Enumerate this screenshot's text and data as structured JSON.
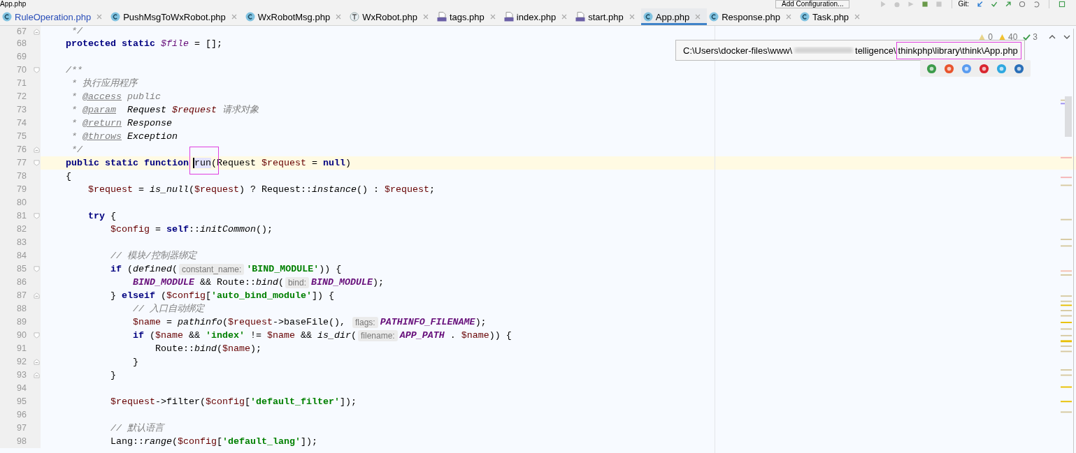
{
  "top_bar": {
    "title": "App.php",
    "run_config_button": "Add Configuration...",
    "vcs_label": "Git:"
  },
  "tabs": [
    {
      "label": "RuleOperation.php",
      "kind": "class",
      "selected": false,
      "modified": true
    },
    {
      "label": "PushMsgToWxRobot.php",
      "kind": "class",
      "selected": false,
      "modified": false
    },
    {
      "label": "WxRobotMsg.php",
      "kind": "class",
      "selected": false,
      "modified": false
    },
    {
      "label": "WxRobot.php",
      "kind": "trait",
      "selected": false,
      "modified": false
    },
    {
      "label": "tags.php",
      "kind": "php",
      "selected": false,
      "modified": false
    },
    {
      "label": "index.php",
      "kind": "php",
      "selected": false,
      "modified": false
    },
    {
      "label": "start.php",
      "kind": "php",
      "selected": false,
      "modified": false
    },
    {
      "label": "App.php",
      "kind": "class",
      "selected": true,
      "modified": false
    },
    {
      "label": "Response.php",
      "kind": "class",
      "selected": false,
      "modified": false
    },
    {
      "label": "Task.php",
      "kind": "class",
      "selected": false,
      "modified": false
    }
  ],
  "inspection": {
    "weak_warnings": "0",
    "warnings": "40",
    "passed": "3"
  },
  "tooltip": {
    "path_start": "C:\\Users\\docker-files\\www\\",
    "path_middle": "telligence\\",
    "path_highlight": "thinkphp\\library\\think\\App.php"
  },
  "editor": {
    "lines": [
      {
        "number": "67",
        "current": false,
        "fold": {
          "kind": "end"
        },
        "tokens": [
          {
            "kind": "comment",
            "text": "     */"
          }
        ]
      },
      {
        "number": "68",
        "current": false,
        "tokens": [
          {
            "kind": "keyword",
            "text": "    protected static "
          },
          {
            "kind": "field",
            "text": "$file"
          },
          {
            "kind": "plain",
            "text": " = [];"
          }
        ]
      },
      {
        "number": "69",
        "current": false
      },
      {
        "number": "70",
        "current": false,
        "fold": {
          "kind": "start"
        },
        "tokens": [
          {
            "kind": "comment",
            "text": "    /**"
          }
        ]
      },
      {
        "number": "71",
        "current": false,
        "tokens": [
          {
            "kind": "comment",
            "text": "     * 执行应用程序"
          }
        ]
      },
      {
        "number": "72",
        "current": false,
        "tokens": [
          {
            "kind": "comment",
            "text": "     * "
          },
          {
            "kind": "doctag",
            "text": "@access"
          },
          {
            "kind": "comment",
            "text": " public"
          }
        ]
      },
      {
        "number": "73",
        "current": false,
        "tokens": [
          {
            "kind": "comment",
            "text": "     * "
          },
          {
            "kind": "doctag",
            "text": "@param"
          },
          {
            "kind": "doctype",
            "text": "  Request "
          },
          {
            "kind": "docvar",
            "text": "$request"
          },
          {
            "kind": "comment",
            "text": " 请求对象"
          }
        ]
      },
      {
        "number": "74",
        "current": false,
        "tokens": [
          {
            "kind": "comment",
            "text": "     * "
          },
          {
            "kind": "doctag",
            "text": "@return"
          },
          {
            "kind": "doctype",
            "text": " Response"
          }
        ]
      },
      {
        "number": "75",
        "current": false,
        "tokens": [
          {
            "kind": "comment",
            "text": "     * "
          },
          {
            "kind": "doctag",
            "text": "@throws"
          },
          {
            "kind": "doctype",
            "text": " Exception"
          }
        ]
      },
      {
        "number": "76",
        "current": false,
        "fold": {
          "kind": "end"
        },
        "tokens": [
          {
            "kind": "comment",
            "text": "     */"
          }
        ]
      },
      {
        "number": "77",
        "current": true,
        "fold": {
          "kind": "start"
        },
        "tokens": [
          {
            "kind": "keyword",
            "text": "    public static function "
          },
          {
            "kind": "caret_ident",
            "text": "run"
          },
          {
            "kind": "plain",
            "text": "(Request "
          },
          {
            "kind": "var",
            "text": "$request"
          },
          {
            "kind": "plain",
            "text": " = "
          },
          {
            "kind": "keyword",
            "text": "null"
          },
          {
            "kind": "plain",
            "text": ")"
          }
        ]
      },
      {
        "number": "78",
        "current": false,
        "tokens": [
          {
            "kind": "plain",
            "text": "    {"
          }
        ]
      },
      {
        "number": "79",
        "current": false,
        "tokens": [
          {
            "kind": "var",
            "text": "        $request"
          },
          {
            "kind": "plain",
            "text": " = "
          },
          {
            "kind": "fn",
            "text": "is_null"
          },
          {
            "kind": "plain",
            "text": "("
          },
          {
            "kind": "var",
            "text": "$request"
          },
          {
            "kind": "plain",
            "text": ") ? Request::"
          },
          {
            "kind": "fn",
            "text": "instance"
          },
          {
            "kind": "plain",
            "text": "() : "
          },
          {
            "kind": "var",
            "text": "$request"
          },
          {
            "kind": "plain",
            "text": ";"
          }
        ]
      },
      {
        "number": "80",
        "current": false
      },
      {
        "number": "81",
        "current": false,
        "fold": {
          "kind": "start"
        },
        "tokens": [
          {
            "kind": "keyword",
            "text": "        try"
          },
          {
            "kind": "plain",
            "text": " {"
          }
        ]
      },
      {
        "number": "82",
        "current": false,
        "tokens": [
          {
            "kind": "var",
            "text": "            $config"
          },
          {
            "kind": "plain",
            "text": " = "
          },
          {
            "kind": "keyword",
            "text": "self"
          },
          {
            "kind": "plain",
            "text": "::"
          },
          {
            "kind": "fn",
            "text": "initCommon"
          },
          {
            "kind": "plain",
            "text": "();"
          }
        ]
      },
      {
        "number": "83",
        "current": false
      },
      {
        "number": "84",
        "current": false,
        "tokens": [
          {
            "kind": "comment",
            "text": "            // 模块/控制器绑定"
          }
        ]
      },
      {
        "number": "85",
        "current": false,
        "fold": {
          "kind": "start"
        },
        "tokens": [
          {
            "kind": "keyword",
            "text": "            if"
          },
          {
            "kind": "plain",
            "text": " ("
          },
          {
            "kind": "fn",
            "text": "defined"
          },
          {
            "kind": "plain",
            "text": "("
          },
          {
            "kind": "hint",
            "text": "constant_name:"
          },
          {
            "kind": "str",
            "text": "'BIND_MODULE'"
          },
          {
            "kind": "plain",
            "text": ")) {"
          }
        ]
      },
      {
        "number": "86",
        "current": false,
        "tokens": [
          {
            "kind": "const",
            "text": "                BIND_MODULE"
          },
          {
            "kind": "plain",
            "text": " && Route::"
          },
          {
            "kind": "fn",
            "text": "bind"
          },
          {
            "kind": "plain",
            "text": "("
          },
          {
            "kind": "hint",
            "text": "bind:"
          },
          {
            "kind": "const",
            "text": "BIND_MODULE"
          },
          {
            "kind": "plain",
            "text": ");"
          }
        ]
      },
      {
        "number": "87",
        "current": false,
        "fold": {
          "kind": "end"
        },
        "tokens": [
          {
            "kind": "plain",
            "text": "            } "
          },
          {
            "kind": "keyword",
            "text": "elseif"
          },
          {
            "kind": "plain",
            "text": " ("
          },
          {
            "kind": "var",
            "text": "$config"
          },
          {
            "kind": "plain",
            "text": "["
          },
          {
            "kind": "str",
            "text": "'auto_bind_module'"
          },
          {
            "kind": "plain",
            "text": "]) {"
          }
        ]
      },
      {
        "number": "88",
        "current": false,
        "tokens": [
          {
            "kind": "comment",
            "text": "                // 入口自动绑定"
          }
        ]
      },
      {
        "number": "89",
        "current": false,
        "tokens": [
          {
            "kind": "var",
            "text": "                $name"
          },
          {
            "kind": "plain",
            "text": " = "
          },
          {
            "kind": "fn",
            "text": "pathinfo"
          },
          {
            "kind": "plain",
            "text": "("
          },
          {
            "kind": "var",
            "text": "$request"
          },
          {
            "kind": "plain",
            "text": "->baseFile(), "
          },
          {
            "kind": "hint",
            "text": "flags:"
          },
          {
            "kind": "const",
            "text": "PATHINFO_FILENAME"
          },
          {
            "kind": "plain",
            "text": ");"
          }
        ]
      },
      {
        "number": "90",
        "current": false,
        "fold": {
          "kind": "start"
        },
        "tokens": [
          {
            "kind": "keyword",
            "text": "                if"
          },
          {
            "kind": "plain",
            "text": " ("
          },
          {
            "kind": "var",
            "text": "$name"
          },
          {
            "kind": "plain",
            "text": " && "
          },
          {
            "kind": "str",
            "text": "'index'"
          },
          {
            "kind": "plain",
            "text": " != "
          },
          {
            "kind": "var",
            "text": "$name"
          },
          {
            "kind": "plain",
            "text": " && "
          },
          {
            "kind": "fn",
            "text": "is_dir"
          },
          {
            "kind": "plain",
            "text": "("
          },
          {
            "kind": "hint",
            "text": "filename:"
          },
          {
            "kind": "const",
            "text": "APP_PATH"
          },
          {
            "kind": "plain",
            "text": " . "
          },
          {
            "kind": "var",
            "text": "$name"
          },
          {
            "kind": "plain",
            "text": ")) {"
          }
        ]
      },
      {
        "number": "91",
        "current": false,
        "tokens": [
          {
            "kind": "plain",
            "text": "                    Route::"
          },
          {
            "kind": "fn",
            "text": "bind"
          },
          {
            "kind": "plain",
            "text": "("
          },
          {
            "kind": "var",
            "text": "$name"
          },
          {
            "kind": "plain",
            "text": ");"
          }
        ]
      },
      {
        "number": "92",
        "current": false,
        "fold": {
          "kind": "end"
        },
        "tokens": [
          {
            "kind": "plain",
            "text": "                }"
          }
        ]
      },
      {
        "number": "93",
        "current": false,
        "fold": {
          "kind": "end"
        },
        "tokens": [
          {
            "kind": "plain",
            "text": "            }"
          }
        ]
      },
      {
        "number": "94",
        "current": false
      },
      {
        "number": "95",
        "current": false,
        "tokens": [
          {
            "kind": "var",
            "text": "            $request"
          },
          {
            "kind": "plain",
            "text": "->filter("
          },
          {
            "kind": "var",
            "text": "$config"
          },
          {
            "kind": "plain",
            "text": "["
          },
          {
            "kind": "str",
            "text": "'default_filter'"
          },
          {
            "kind": "plain",
            "text": "]);"
          }
        ]
      },
      {
        "number": "96",
        "current": false
      },
      {
        "number": "97",
        "current": false,
        "tokens": [
          {
            "kind": "comment",
            "text": "            // 默认语言"
          }
        ]
      },
      {
        "number": "98",
        "current": false,
        "tokens": [
          {
            "kind": "plain",
            "text": "            Lang::"
          },
          {
            "kind": "fn",
            "text": "range"
          },
          {
            "kind": "plain",
            "text": "("
          },
          {
            "kind": "var",
            "text": "$config"
          },
          {
            "kind": "plain",
            "text": "["
          },
          {
            "kind": "str",
            "text": "'default_lang'"
          },
          {
            "kind": "plain",
            "text": "]);"
          }
        ]
      }
    ]
  }
}
